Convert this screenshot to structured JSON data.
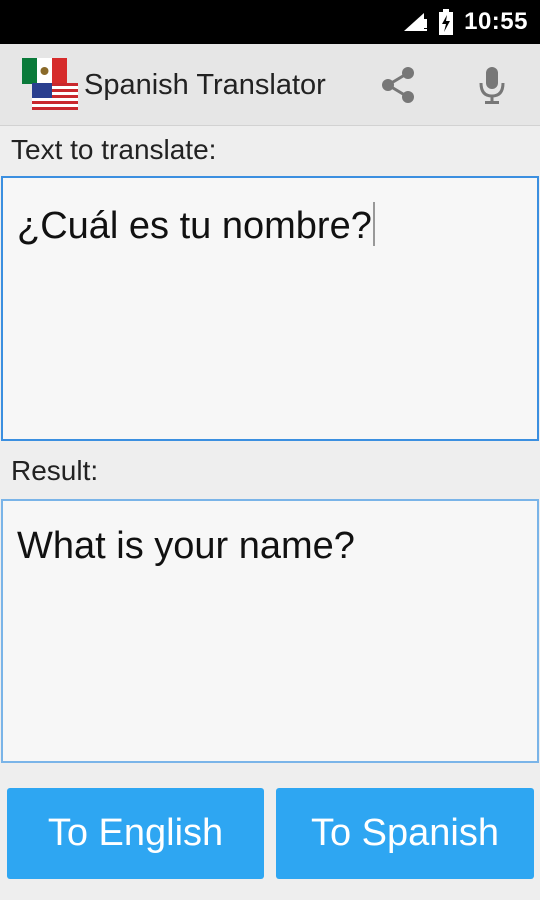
{
  "status_bar": {
    "time": "10:55",
    "icons": [
      "signal-icon",
      "battery-charging-icon"
    ]
  },
  "action_bar": {
    "title": "Spanish Translator",
    "icons": [
      "mexico-flag-icon",
      "usa-flag-icon",
      "share-icon",
      "microphone-icon"
    ]
  },
  "input": {
    "label": "Text to translate:",
    "value": "¿Cuál es tu nombre?"
  },
  "result": {
    "label": "Result:",
    "value": "What is your name?"
  },
  "buttons": {
    "to_english": "To English",
    "to_spanish": "To Spanish"
  },
  "colors": {
    "button_blue": "#2ea6f2",
    "field_border": "#3b8fe0",
    "action_bar_bg": "#e6e6e6"
  }
}
